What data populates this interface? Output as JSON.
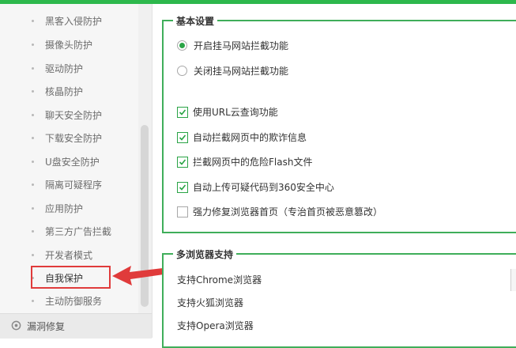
{
  "sidebar": {
    "items": [
      {
        "label": "黑客入侵防护"
      },
      {
        "label": "摄像头防护"
      },
      {
        "label": "驱动防护"
      },
      {
        "label": "核晶防护"
      },
      {
        "label": "聊天安全防护"
      },
      {
        "label": "下载安全防护"
      },
      {
        "label": "U盘安全防护"
      },
      {
        "label": "隔离可疑程序"
      },
      {
        "label": "应用防护"
      },
      {
        "label": "第三方广告拦截"
      },
      {
        "label": "开发者模式"
      },
      {
        "label": "自我保护"
      },
      {
        "label": "主动防御服务"
      }
    ],
    "footer_label": "漏洞修复"
  },
  "basic": {
    "title": "基本设置",
    "radio_on_label": "开启挂马网站拦截功能",
    "radio_off_label": "关闭挂马网站拦截功能",
    "checks": [
      {
        "label": "使用URL云查询功能",
        "checked": true
      },
      {
        "label": "自动拦截网页中的欺诈信息",
        "checked": true
      },
      {
        "label": "拦截网页中的危险Flash文件",
        "checked": true
      },
      {
        "label": "自动上传可疑代码到360安全中心",
        "checked": true
      },
      {
        "label": "强力修复浏览器首页（专治首页被恶意篡改）",
        "checked": false
      }
    ]
  },
  "browsers": {
    "title": "多浏览器支持",
    "items": [
      {
        "label": "支持Chrome浏览器"
      },
      {
        "label": "支持火狐浏览器"
      },
      {
        "label": "支持Opera浏览器"
      }
    ]
  },
  "colors": {
    "accent": "#2db84c",
    "highlight": "#e03b3b"
  }
}
